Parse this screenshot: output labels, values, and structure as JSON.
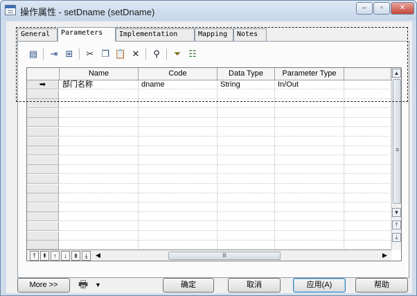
{
  "window": {
    "title": "操作属性 - setDname (setDname)",
    "controls": {
      "minimize": "–",
      "maximize": "▫",
      "close": "✕"
    }
  },
  "tabs": [
    {
      "label": "General",
      "active": false
    },
    {
      "label": "Parameters",
      "active": true
    },
    {
      "label": "Implementation",
      "active": false
    },
    {
      "label": "Mapping",
      "active": false
    },
    {
      "label": "Notes",
      "active": false
    }
  ],
  "toolbar": {
    "icons": [
      "properties-icon",
      "insert-row-icon",
      "add-row-icon",
      "cut-icon",
      "copy-icon",
      "paste-icon",
      "delete-icon",
      "find-icon",
      "filter-icon",
      "customize-columns-icon"
    ]
  },
  "grid": {
    "columns": [
      "Name",
      "Code",
      "Data Type",
      "Parameter Type"
    ],
    "rows": [
      {
        "marker": "➡",
        "cells": [
          "部门名称",
          "dname",
          "String",
          "In/Out"
        ]
      }
    ],
    "nav_buttons": [
      "⤒",
      "⇞",
      "↑",
      "↓",
      "⇟",
      "⤓"
    ],
    "hscroll_grip": "lll",
    "vscroll_grip": "≡"
  },
  "footer": {
    "more": "More >>",
    "ok": "确定",
    "cancel": "取消",
    "apply": "应用(A)",
    "help": "帮助"
  }
}
